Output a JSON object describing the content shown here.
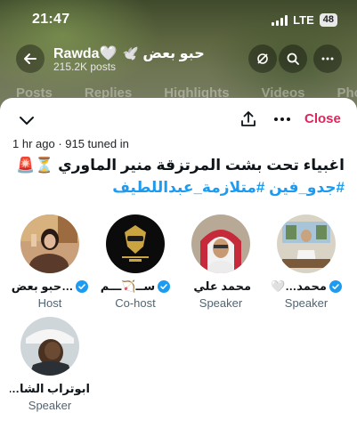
{
  "status_bar": {
    "time": "21:47",
    "network": "LTE",
    "battery": "48"
  },
  "profile_header": {
    "name": "Rawda🤍 🕊️ حبو بعض",
    "posts": "215.2K posts",
    "tabs": [
      "Posts",
      "Replies",
      "Highlights",
      "Videos",
      "Photos"
    ]
  },
  "space": {
    "collapse_icon": "chevron-down-icon",
    "share_icon": "share-icon",
    "more_icon": "more-dots-icon",
    "close_label": "Close",
    "meta": "1 hr ago · 915 tuned in",
    "title": "اغبياء تحت بشت المرتزقة منير الماوري ⏳🚨",
    "hashtags": "#جدو_فين #متلازمة_عبداللطيف",
    "participants": [
      {
        "name": "حبو بعض…",
        "role": "Host",
        "verified": true
      },
      {
        "name": "ســ🏹ـــم",
        "role": "Co-host",
        "verified": true
      },
      {
        "name": "محمد علي (ب…",
        "role": "Speaker",
        "verified": false
      },
      {
        "name": "محمد…🤍",
        "role": "Speaker",
        "verified": true
      },
      {
        "name": "ابوتراب الشا…",
        "role": "Speaker",
        "verified": false
      }
    ]
  },
  "colors": {
    "accent_red": "#e0245e",
    "hashtag_blue": "#1d9bf0",
    "verified_blue": "#1d9bf0"
  }
}
